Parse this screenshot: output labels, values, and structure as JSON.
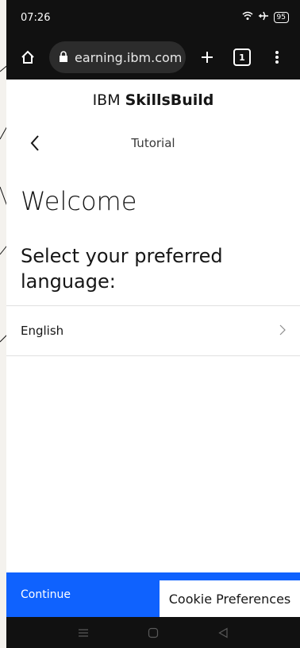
{
  "status_bar": {
    "time": "07:26",
    "battery": "95",
    "icons": [
      "wifi-icon",
      "airplane-icon",
      "battery-icon"
    ]
  },
  "browser": {
    "url": "earning.ibm.com",
    "tab_count": "1",
    "icons": [
      "home-icon",
      "lock-icon",
      "plus-icon",
      "tabs-icon",
      "more-icon"
    ]
  },
  "brand": {
    "prefix": "IBM",
    "name": "SkillsBuild"
  },
  "nav": {
    "title": "Tutorial",
    "back_icon": "chevron-left-icon"
  },
  "page": {
    "heading": "Welcome",
    "prompt": "Select your preferred language:"
  },
  "languages": [
    {
      "label": "English"
    }
  ],
  "footer": {
    "continue_label": "Continue",
    "cookie_label": "Cookie Preferences"
  },
  "colors": {
    "accent": "#0f62fe",
    "bar": "#111111"
  },
  "system_nav": {
    "icons": [
      "menu-icon",
      "home-square-icon",
      "back-triangle-icon"
    ]
  }
}
